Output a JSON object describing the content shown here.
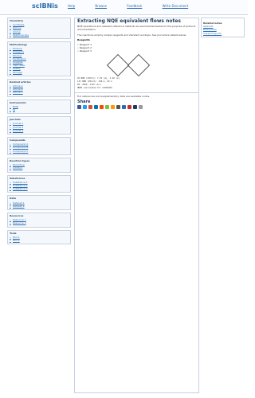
{
  "header": {
    "logo": "scIBNis",
    "nav": [
      "Help",
      "Browse",
      "Feedback",
      "Write Document"
    ]
  },
  "sidebar": {
    "sections": [
      {
        "title": "Chemistry",
        "items": [
          "Synthesis",
          "Ketone",
          "Amine",
          "Spectroscopy"
        ]
      },
      {
        "title": "Methodology",
        "items": [
          "Protocol",
          "Reagents",
          "Workup",
          "Purification",
          "Analysis",
          "Yield data",
          "Safety",
          "Storage"
        ]
      },
      {
        "title": "Related articles",
        "items": [
          "Article A",
          "Article B",
          "Article C"
        ]
      },
      {
        "title": "Instruments",
        "items": [
          "NMR",
          "IR"
        ]
      },
      {
        "title": "Journals",
        "items": [
          "Journal 1",
          "Journal 2",
          "Journal 3"
        ]
      },
      {
        "title": "Compounds",
        "items": [
          "Compound A",
          "Compound B",
          "Compound C"
        ]
      },
      {
        "title": "Reaction types",
        "items": [
          "Reductive",
          "Addition"
        ]
      },
      {
        "title": "Substances",
        "items": [
          "Substance 1",
          "Substance 2",
          "Substance 3"
        ]
      },
      {
        "title": "Data",
        "items": [
          "Dataset 1",
          "Dataset 2"
        ]
      },
      {
        "title": "Resources",
        "items": [
          "Resource 1",
          "Resource 2"
        ]
      },
      {
        "title": "Tools",
        "items": [
          "Tool 1",
          "Tool 2"
        ]
      }
    ]
  },
  "main": {
    "title": "Extracting NQE equivalent flows notes",
    "intro": "NQE operations and relevant reference material are summarized below for the purpose of protocol documentation.",
    "para2": "The reactions employ simple reagents and standard workups. See procedure details below.",
    "list_title": "Reagents",
    "list_items": [
      "Reagent 1",
      "Reagent 2",
      "Reagent 3"
    ],
    "code": [
      "1H NMR (CDCl3): 7.25 (m), 3.40 (s)",
      "13C NMR (CDCl3): 128.4, 62.1",
      "IR: 2950, 1725 cm-1",
      "HRMS calculated for C10H12O2"
    ],
    "links_text": "Full references and supplementary data are available online.",
    "share_label": "Share"
  },
  "right": {
    "title": "Related notes",
    "links": [
      "Abstract",
      "References",
      "Supporting info"
    ]
  },
  "share_colors": [
    "#3b5998",
    "#1da1f2",
    "#dd4b39",
    "#0077b5",
    "#ff4500",
    "#7ac142",
    "#ff9900",
    "#555555",
    "#2a6db0",
    "#c4302b",
    "#1f3b5c",
    "#999999"
  ]
}
